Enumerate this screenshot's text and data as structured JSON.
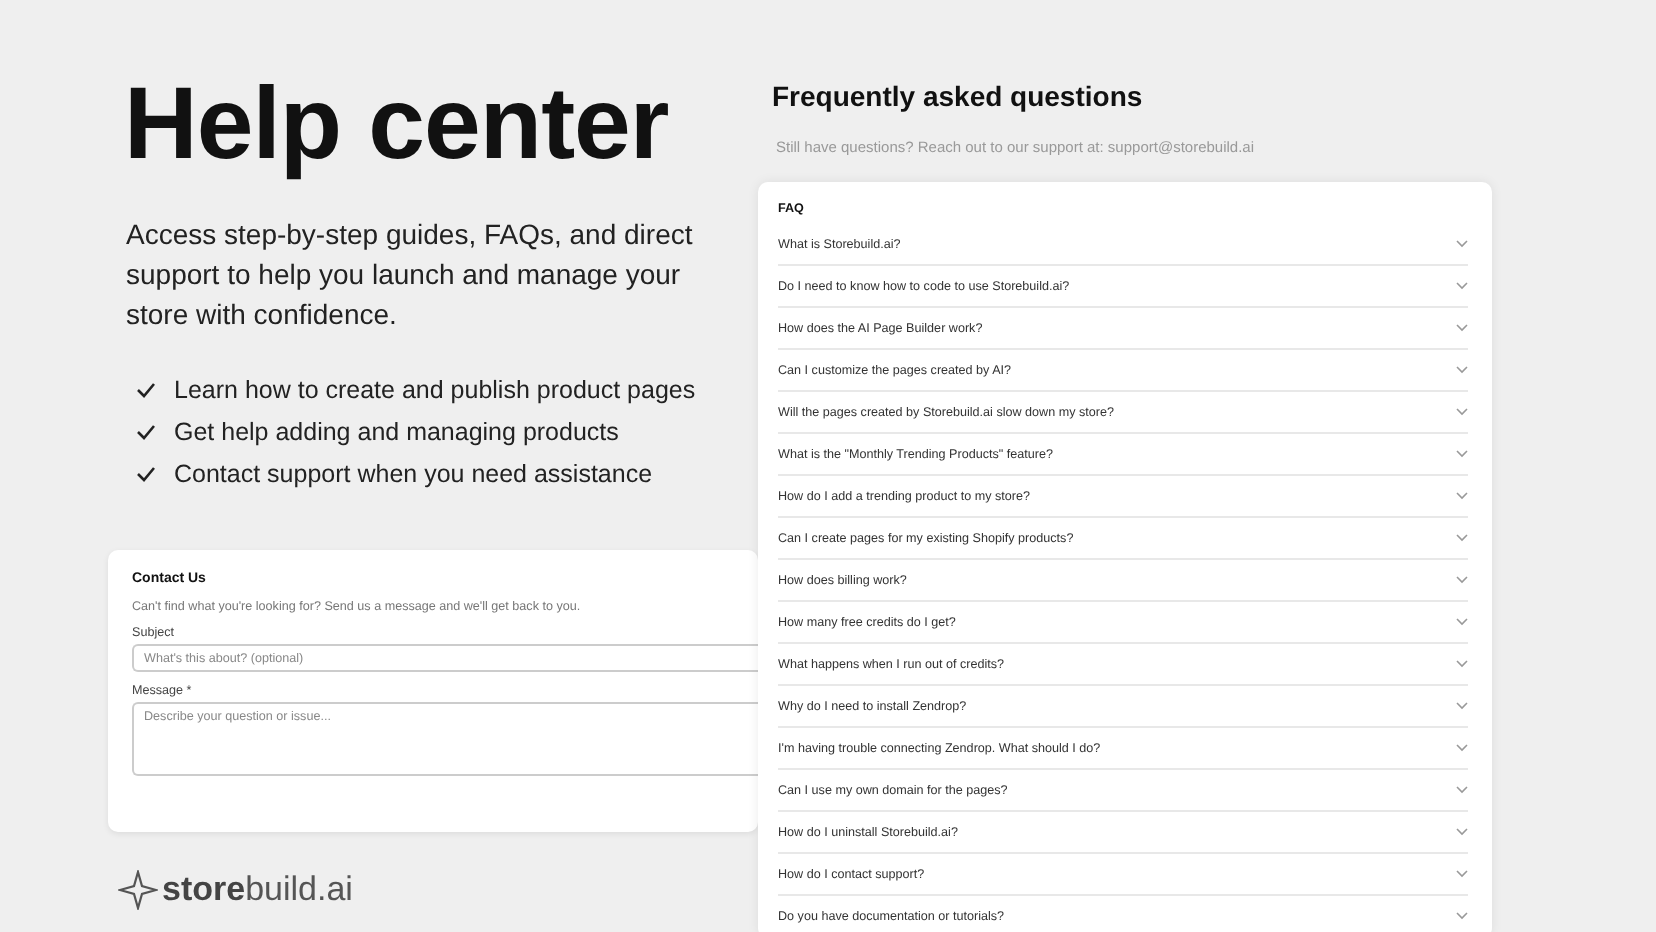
{
  "hero": {
    "title": "Help center",
    "description": "Access step-by-step guides, FAQs, and direct support to help you launch and manage your store with confidence.",
    "features": [
      "Learn how to create and publish product pages",
      "Get help adding and managing products",
      "Contact support when you need assistance"
    ]
  },
  "contact": {
    "title": "Contact Us",
    "description": "Can't find what you're looking for? Send us a message and we'll get back to you.",
    "fields": [
      {
        "label": "Subject",
        "placeholder": "What's this about? (optional)",
        "kind": "input"
      },
      {
        "label": "Message *",
        "placeholder": "Describe your question or issue...",
        "kind": "textarea"
      }
    ]
  },
  "logo": {
    "text": "**store**build.ai"
  },
  "faq": {
    "title": "Frequently asked questions",
    "subtitle": "Still have questions? Reach out to our support at: support@storebuild.ai",
    "section": "FAQ",
    "items": [
      {
        "question": "What is Storebuild.ai?",
        "expanded": false
      },
      {
        "question": "Do I need to know how to code to use Storebuild.ai?",
        "expanded": false
      },
      {
        "question": "How does the AI Page Builder work?",
        "expanded": false
      },
      {
        "question": "Can I customize the pages created by AI?",
        "expanded": false
      },
      {
        "question": "Will the pages created by Storebuild.ai slow down my store?",
        "expanded": false
      },
      {
        "question": "What is the \"Monthly Trending Products\" feature?",
        "expanded": false
      },
      {
        "question": "How do I add a trending product to my store?",
        "expanded": false
      },
      {
        "question": "Can I create pages for my existing Shopify products?",
        "expanded": false
      },
      {
        "question": "How does billing work?",
        "expanded": false
      },
      {
        "question": "How many free credits do I get?",
        "expanded": false
      },
      {
        "question": "What happens when I run out of credits?",
        "expanded": false
      },
      {
        "question": "Why do I need to install Zendrop?",
        "expanded": false
      },
      {
        "question": "I'm having trouble connecting Zendrop. What should I do?",
        "expanded": false
      },
      {
        "question": "Can I use my own domain for the pages?",
        "expanded": false
      },
      {
        "question": "How do I uninstall Storebuild.ai?",
        "expanded": false
      },
      {
        "question": "How do I contact support?",
        "expanded": false
      },
      {
        "question": "Do you have documentation or tutorials?",
        "expanded": false
      }
    ]
  }
}
